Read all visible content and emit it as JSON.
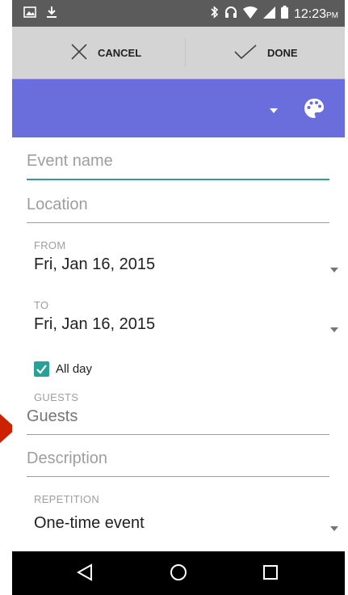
{
  "status_bar": {
    "time": "12:23",
    "ampm": "PM",
    "left_icons": [
      "image-icon",
      "download-icon"
    ],
    "right_icons": [
      "bluetooth-icon",
      "headphones-icon",
      "wifi-icon",
      "signal-icon",
      "battery-icon"
    ]
  },
  "action_bar": {
    "cancel_label": "CANCEL",
    "done_label": "DONE"
  },
  "color_bar": {
    "color": "#6a6edc",
    "icons": [
      "caret-down-icon",
      "palette-icon"
    ]
  },
  "form": {
    "event_name_placeholder": "Event name",
    "location_placeholder": "Location",
    "from_label": "FROM",
    "from_value": "Fri, Jan 16, 2015",
    "to_label": "TO",
    "to_value": "Fri, Jan 16, 2015",
    "all_day_label": "All day",
    "all_day_checked": true,
    "guests_label": "GUESTS",
    "guests_placeholder": "Guests",
    "description_placeholder": "Description",
    "repetition_label": "REPETITION",
    "repetition_value": "One-time event"
  },
  "nav_bar": {
    "icons": [
      "back-icon",
      "home-icon",
      "recents-icon"
    ]
  },
  "colors": {
    "accent": "#2aa198",
    "action_bar": "#d4d4d4",
    "status_bar": "#5b5b5b",
    "pointer": "#cc2200"
  }
}
